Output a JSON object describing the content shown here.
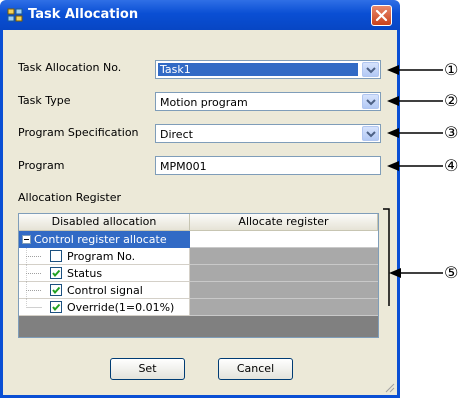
{
  "window": {
    "title": "Task Allocation"
  },
  "form": {
    "task_allocation_no": {
      "label": "Task Allocation No.",
      "value": "Task1"
    },
    "task_type": {
      "label": "Task Type",
      "value": "Motion program"
    },
    "program_specification": {
      "label": "Program Specification",
      "value": "Direct"
    },
    "program": {
      "label": "Program",
      "value": "MPM001"
    },
    "allocation_register_label": "Allocation Register"
  },
  "grid": {
    "columns": [
      "Disabled allocation",
      "Allocate register"
    ],
    "group": "Control register allocate",
    "rows": [
      {
        "label": "Program No.",
        "checked": false
      },
      {
        "label": "Status",
        "checked": true
      },
      {
        "label": "Control signal",
        "checked": true
      },
      {
        "label": "Override(1=0.01%)",
        "checked": true
      }
    ]
  },
  "buttons": {
    "set": "Set",
    "cancel": "Cancel"
  },
  "callouts": [
    "①",
    "②",
    "③",
    "④",
    "⑤"
  ]
}
